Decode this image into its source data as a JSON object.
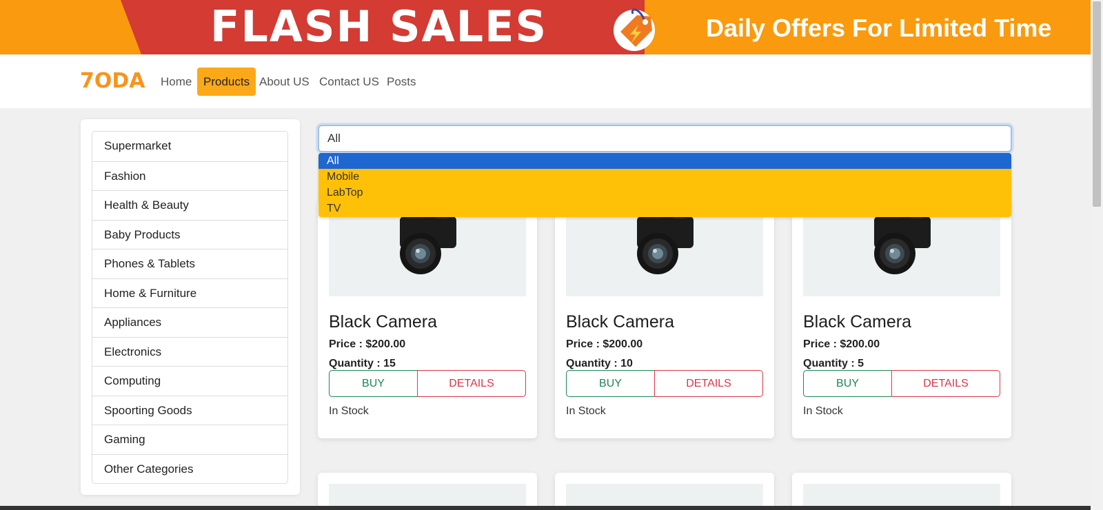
{
  "banner": {
    "title": "FLASH SALES",
    "subtitle": "Daily Offers For Limited Time"
  },
  "navbar": {
    "brand": "7ODA",
    "links": [
      {
        "label": "Home",
        "active": false
      },
      {
        "label": "Products",
        "active": true
      },
      {
        "label": "About US",
        "active": false
      },
      {
        "label": "Contact US",
        "active": false
      },
      {
        "label": "Posts",
        "active": false
      }
    ]
  },
  "sidebar": {
    "categories": [
      "Supermarket",
      "Fashion",
      "Health & Beauty",
      "Baby Products",
      "Phones & Tablets",
      "Home & Furniture",
      "Appliances",
      "Electronics",
      "Computing",
      "Spoorting Goods",
      "Gaming",
      "Other Categories"
    ]
  },
  "filter": {
    "selected": "All",
    "options": [
      "All",
      "Mobile",
      "LabTop",
      "TV"
    ]
  },
  "products": [
    {
      "name": "Black Camera",
      "price": "Price : $200.00",
      "quantity": "Quantity : 15",
      "buy": "BUY",
      "details": "DETAILS",
      "stock": "In Stock"
    },
    {
      "name": "Black Camera",
      "price": "Price : $200.00",
      "quantity": "Quantity : 10",
      "buy": "BUY",
      "details": "DETAILS",
      "stock": "In Stock"
    },
    {
      "name": "Black Camera",
      "price": "Price : $200.00",
      "quantity": "Quantity : 5",
      "buy": "BUY",
      "details": "DETAILS",
      "stock": "In Stock"
    }
  ],
  "colors": {
    "banner_orange": "#fa9a0e",
    "banner_red": "#d33b33",
    "brand": "#f7941d",
    "nav_active": "#fba919",
    "dropdown_bg": "#ffc107",
    "option_selected": "#1e66d0",
    "buy": "#198754",
    "details": "#dc3545"
  }
}
